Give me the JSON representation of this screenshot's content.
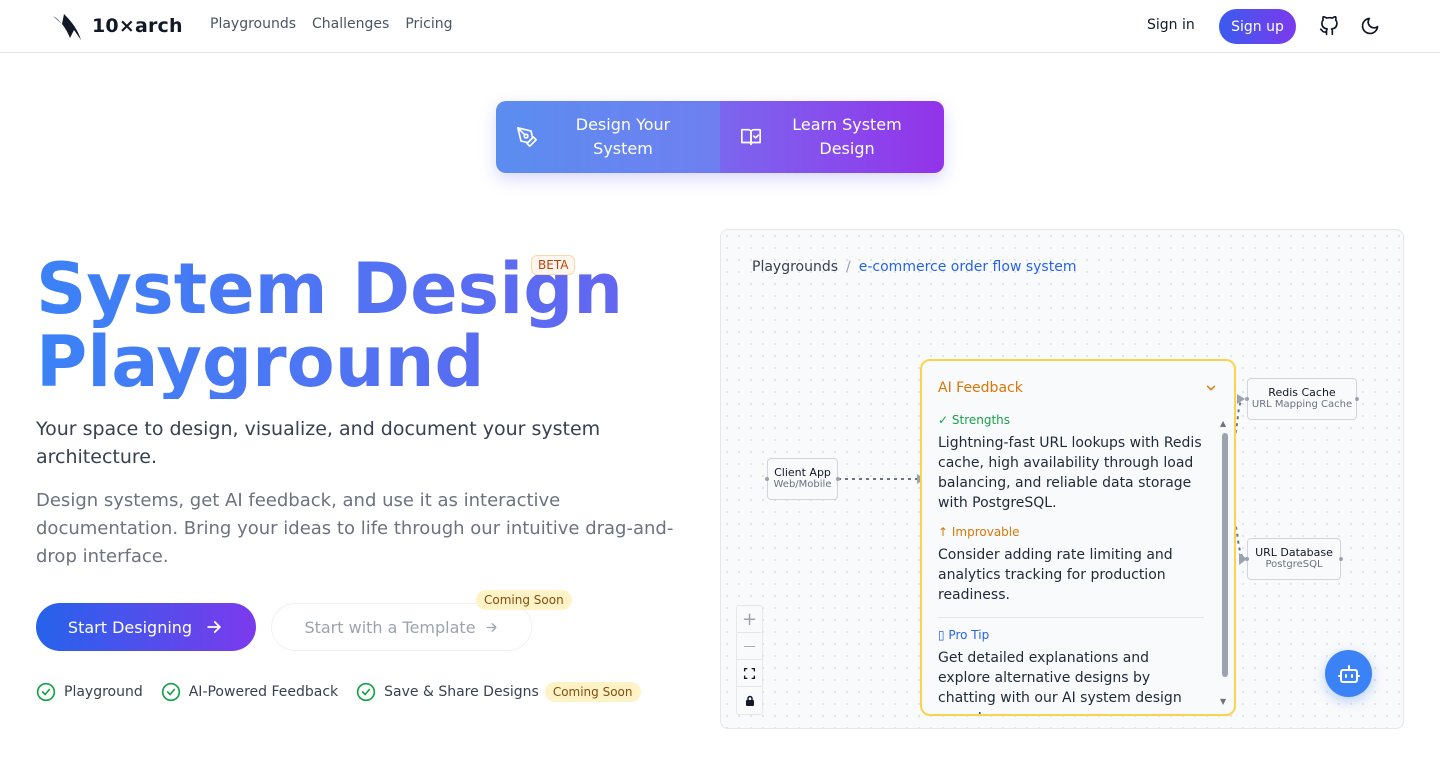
{
  "nav": {
    "brand": "10×arch",
    "links": [
      "Playgrounds",
      "Challenges",
      "Pricing"
    ],
    "sign_in": "Sign in",
    "sign_up": "Sign up"
  },
  "mode_toggle": {
    "design_label": "Design Your System",
    "learn_label": "Learn System Design"
  },
  "hero": {
    "title_line1": "System Design",
    "title_line2": "Playground",
    "beta": "BETA",
    "lead": "Your space to design, visualize, and document your system architecture.",
    "sub": "Design systems, get AI feedback, and use it as interactive documentation. Bring your ideas to life through our intuitive drag-and-drop interface.",
    "start_button": "Start Designing",
    "template_button": "Start with a Template",
    "template_badge": "Coming Soon",
    "features": [
      "Playground",
      "AI-Powered Feedback",
      "Save & Share Designs"
    ],
    "features_badge": "Coming Soon"
  },
  "demo": {
    "breadcrumb_root": "Playgrounds",
    "breadcrumb_sep": "/",
    "breadcrumb_current": "e-commerce order flow system",
    "nodes": {
      "client": {
        "title": "Client App",
        "subtitle": "Web/Mobile"
      },
      "redis": {
        "title": "Redis Cache",
        "subtitle": "URL Mapping Cache"
      },
      "db": {
        "title": "URL Database",
        "subtitle": "PostgreSQL"
      }
    },
    "feedback": {
      "title": "AI Feedback",
      "strengths_label": "✓ Strengths",
      "strengths_text": "Lightning-fast URL lookups with Redis cache, high availability through load balancing, and reliable data storage with PostgreSQL.",
      "improvable_label": "↑ Improvable",
      "improvable_text": "Consider adding rate limiting and analytics tracking for production readiness.",
      "tip_label": "▯ Pro Tip",
      "tip_text": "Get detailed explanations and explore alternative designs by chatting with our AI system design expert."
    },
    "zoom_controls": [
      "+",
      "—",
      "⛶",
      "🔒"
    ]
  },
  "colors": {
    "primary": "#2563eb",
    "accent": "#7c3aed",
    "feedback_border": "#fcd34d",
    "success": "#16a34a"
  }
}
